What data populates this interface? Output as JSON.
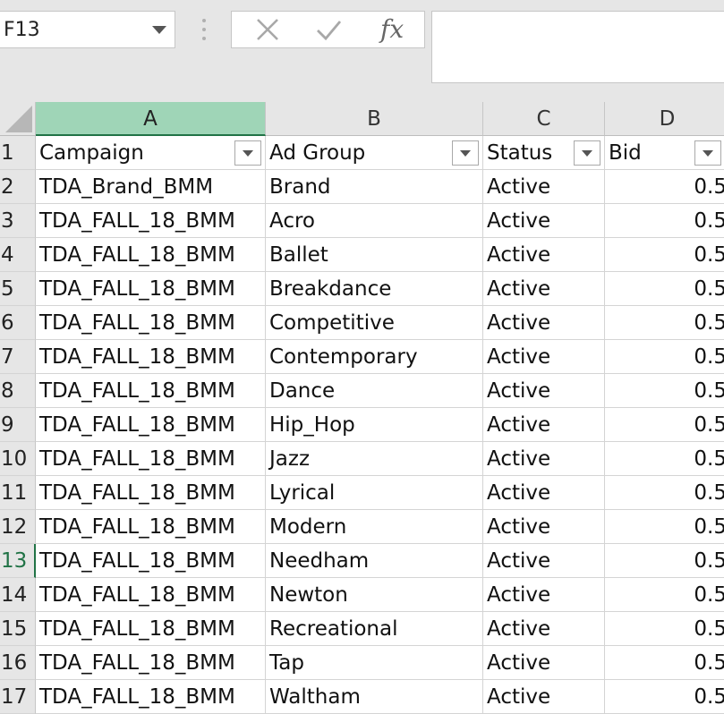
{
  "formula_bar": {
    "name_box": "F13",
    "cancel_icon": "close-icon",
    "enter_icon": "checkmark-icon",
    "function_label": "fx",
    "formula_value": ""
  },
  "colors": {
    "selected_header": "#9fd5b7",
    "selection_accent": "#217346",
    "header_bg": "#e6e6e6"
  },
  "columns": [
    "A",
    "B",
    "C",
    "D"
  ],
  "selected_column": "A",
  "selected_row": "13",
  "header_row": {
    "row": "1",
    "campaign": "Campaign",
    "ad_group": "Ad Group",
    "status": "Status",
    "bid": "Bid"
  },
  "rows": [
    {
      "row": "2",
      "campaign": "TDA_Brand_BMM",
      "ad_group": "Brand",
      "status": "Active",
      "bid": "0.5"
    },
    {
      "row": "3",
      "campaign": "TDA_FALL_18_BMM",
      "ad_group": "Acro",
      "status": "Active",
      "bid": "0.5"
    },
    {
      "row": "4",
      "campaign": "TDA_FALL_18_BMM",
      "ad_group": "Ballet",
      "status": "Active",
      "bid": "0.5"
    },
    {
      "row": "5",
      "campaign": "TDA_FALL_18_BMM",
      "ad_group": "Breakdance",
      "status": "Active",
      "bid": "0.5"
    },
    {
      "row": "6",
      "campaign": "TDA_FALL_18_BMM",
      "ad_group": "Competitive",
      "status": "Active",
      "bid": "0.5"
    },
    {
      "row": "7",
      "campaign": "TDA_FALL_18_BMM",
      "ad_group": "Contemporary",
      "status": "Active",
      "bid": "0.5"
    },
    {
      "row": "8",
      "campaign": "TDA_FALL_18_BMM",
      "ad_group": "Dance",
      "status": "Active",
      "bid": "0.5"
    },
    {
      "row": "9",
      "campaign": "TDA_FALL_18_BMM",
      "ad_group": "Hip_Hop",
      "status": "Active",
      "bid": "0.5"
    },
    {
      "row": "10",
      "campaign": "TDA_FALL_18_BMM",
      "ad_group": "Jazz",
      "status": "Active",
      "bid": "0.5"
    },
    {
      "row": "11",
      "campaign": "TDA_FALL_18_BMM",
      "ad_group": "Lyrical",
      "status": "Active",
      "bid": "0.5"
    },
    {
      "row": "12",
      "campaign": "TDA_FALL_18_BMM",
      "ad_group": "Modern",
      "status": "Active",
      "bid": "0.5"
    },
    {
      "row": "13",
      "campaign": "TDA_FALL_18_BMM",
      "ad_group": "Needham",
      "status": "Active",
      "bid": "0.5"
    },
    {
      "row": "14",
      "campaign": "TDA_FALL_18_BMM",
      "ad_group": "Newton",
      "status": "Active",
      "bid": "0.5"
    },
    {
      "row": "15",
      "campaign": "TDA_FALL_18_BMM",
      "ad_group": "Recreational",
      "status": "Active",
      "bid": "0.5"
    },
    {
      "row": "16",
      "campaign": "TDA_FALL_18_BMM",
      "ad_group": "Tap",
      "status": "Active",
      "bid": "0.5"
    },
    {
      "row": "17",
      "campaign": "TDA_FALL_18_BMM",
      "ad_group": "Waltham",
      "status": "Active",
      "bid": "0.5"
    }
  ]
}
